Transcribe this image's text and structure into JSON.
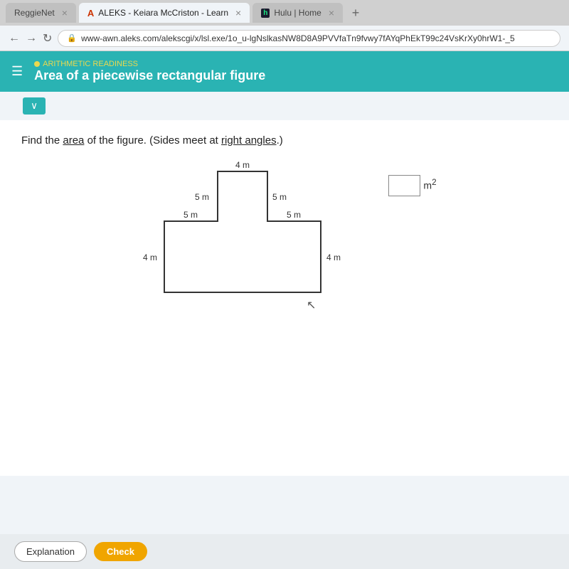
{
  "browser": {
    "tabs": [
      {
        "id": "reggiennet",
        "label": "ReggieNet",
        "active": false,
        "icon": ""
      },
      {
        "id": "aleks",
        "label": "ALEKS - Keiara McCriston - Learn",
        "active": true,
        "icon": "A"
      },
      {
        "id": "hulu",
        "label": "Hulu | Home",
        "active": false,
        "icon": "h"
      }
    ],
    "url": "www-awn.aleks.com/alekscgi/x/lsl.exe/1o_u-lgNslkasNW8D8A9PVVfaTn9fvwy7fAYqPhEkT99c24VsKrXy0hrW1-_5"
  },
  "header": {
    "subject": "ARITHMETIC READINESS",
    "title": "Area of a piecewise rectangular figure"
  },
  "question": {
    "text": "Find the area of the figure. (Sides meet at right angles.)",
    "area_word": "area",
    "right_angles_word": "right angles",
    "dimensions": {
      "top": "4 m",
      "left_top": "5 m",
      "right_top": "5 m",
      "middle_left": "5 m",
      "middle_right": "5 m",
      "bottom_left": "4 m",
      "bottom_right": "4 m"
    }
  },
  "answer": {
    "input_value": "",
    "unit": "m",
    "exponent": "2"
  },
  "buttons": {
    "explanation": "Explanation",
    "check": "Check",
    "expand": "∨"
  }
}
